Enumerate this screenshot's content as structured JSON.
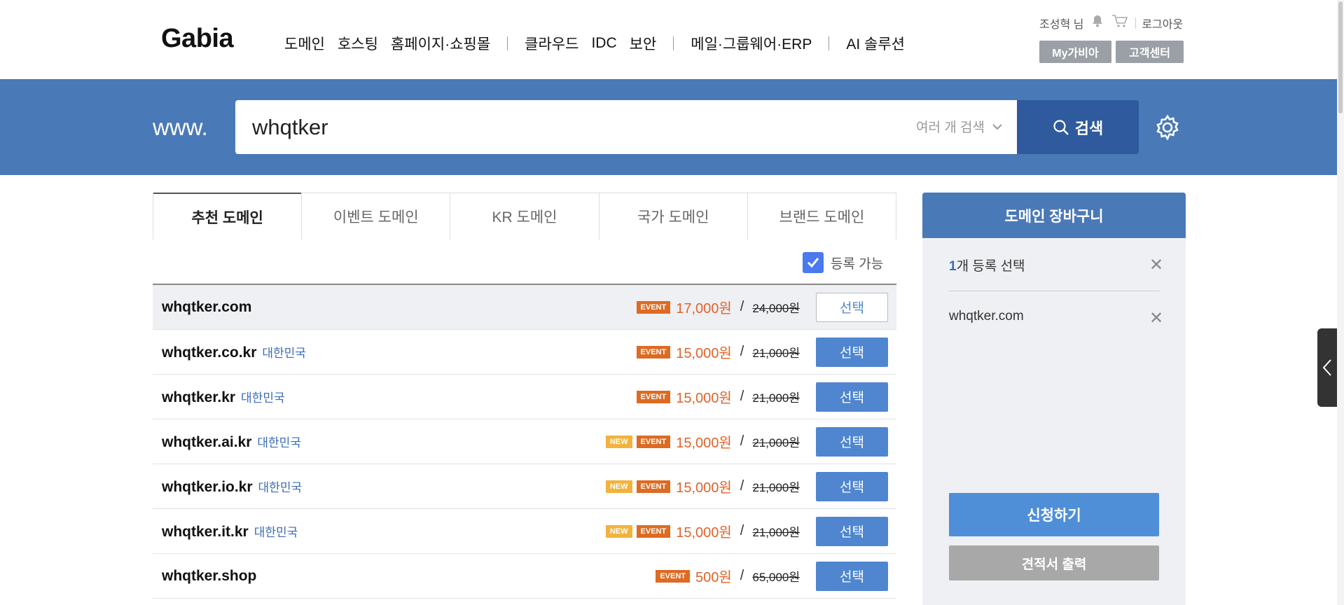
{
  "header": {
    "logo": "Gabia",
    "nav": [
      "도메인",
      "호스팅",
      "홈페이지·쇼핑몰",
      "클라우드",
      "IDC",
      "보안",
      "메일·그룹웨어·ERP",
      "AI 솔루션"
    ],
    "user": "조성혁 님",
    "logout": "로그아웃",
    "mygabia": "My가비아",
    "support": "고객센터"
  },
  "search": {
    "prefix": "www.",
    "value": "whqtker",
    "multi": "여러 개 검색",
    "button": "검색"
  },
  "tabs": [
    "추천 도메인",
    "이벤트 도메인",
    "KR 도메인",
    "국가 도메인",
    "브랜드 도메인"
  ],
  "filter": {
    "label": "등록 가능",
    "checked": true
  },
  "results": [
    {
      "domain": "whqtker.com",
      "country": "",
      "new": false,
      "event": true,
      "price": "17,000원",
      "original": "24,000원",
      "button": "선택",
      "selected": true
    },
    {
      "domain": "whqtker.co.kr",
      "country": "대한민국",
      "new": false,
      "event": true,
      "price": "15,000원",
      "original": "21,000원",
      "button": "선택",
      "selected": false
    },
    {
      "domain": "whqtker.kr",
      "country": "대한민국",
      "new": false,
      "event": true,
      "price": "15,000원",
      "original": "21,000원",
      "button": "선택",
      "selected": false
    },
    {
      "domain": "whqtker.ai.kr",
      "country": "대한민국",
      "new": true,
      "event": true,
      "price": "15,000원",
      "original": "21,000원",
      "button": "선택",
      "selected": false
    },
    {
      "domain": "whqtker.io.kr",
      "country": "대한민국",
      "new": true,
      "event": true,
      "price": "15,000원",
      "original": "21,000원",
      "button": "선택",
      "selected": false
    },
    {
      "domain": "whqtker.it.kr",
      "country": "대한민국",
      "new": true,
      "event": true,
      "price": "15,000원",
      "original": "21,000원",
      "button": "선택",
      "selected": false
    },
    {
      "domain": "whqtker.shop",
      "country": "",
      "new": false,
      "event": true,
      "price": "500원",
      "original": "65,000원",
      "button": "선택",
      "selected": false
    }
  ],
  "badges": {
    "new": "NEW",
    "event": "EVENT"
  },
  "cart": {
    "title": "도메인 장바구니",
    "count_num": "1",
    "count_text": "개 등록 선택",
    "item": "whqtker.com",
    "apply": "신청하기",
    "quote": "견적서 출력"
  },
  "colors": {
    "brand": "#4a79b8",
    "accent_orange": "#e0632a",
    "button_blue": "#4f86cf"
  }
}
